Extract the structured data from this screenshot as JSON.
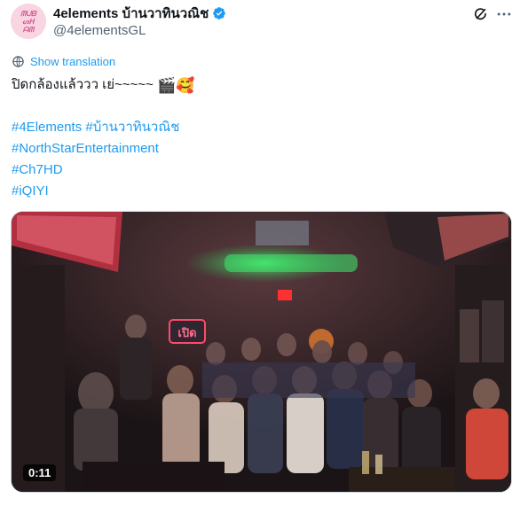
{
  "author": {
    "display_name": "4elements บ้านวาทินวณิช",
    "handle": "@4elementsGL",
    "avatar_text": "ᗰᑌᗷ ᔕᕼ ᗩᗰ",
    "verified": true
  },
  "actions": {
    "translate_label": "Show translation"
  },
  "tweet": {
    "line1": "ปิดกล้องแล้ววว เย่~~~~~",
    "line1_emojis": "🎬🥰",
    "hashtags": [
      "#4Elements",
      "#บ้านวาทินวณิช",
      "#NorthStarEntertainment",
      "#Ch7HD",
      "#iQIYI"
    ]
  },
  "media": {
    "duration": "0:11",
    "sign_text": "เปิด"
  },
  "colors": {
    "link": "#1d9bf0",
    "secondary_text": "#536471",
    "verified": "#1d9bf0"
  }
}
